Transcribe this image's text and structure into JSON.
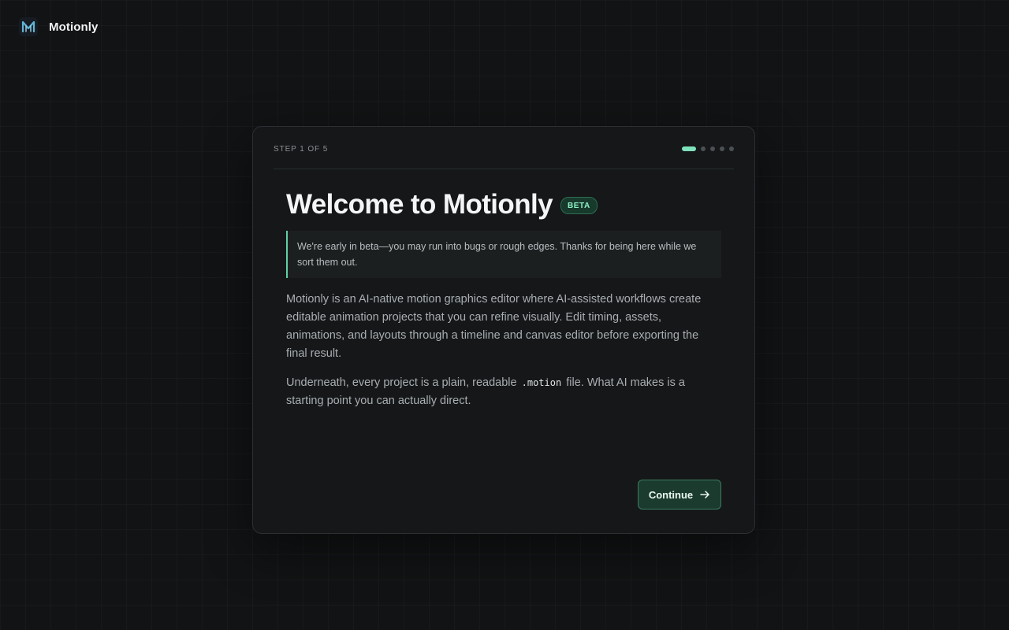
{
  "app": {
    "name": "Motionly",
    "logo_icon": "motionly-m-logo-icon"
  },
  "onboarding": {
    "step_label": "STEP 1 OF 5",
    "total_steps": 5,
    "current_step": 1,
    "title": "Welcome to Motionly",
    "badge": "BETA",
    "notice": "We're early in beta—you may run into bugs or rough edges. Thanks for being here while we sort them out.",
    "paragraph_1": "Motionly is an AI-native motion graphics editor where AI-assisted workflows create editable animation projects that you can refine visually. Edit timing, assets, animations, and layouts through a timeline and canvas editor before exporting the final result.",
    "paragraph_2_before": "Underneath, every project is a plain, readable ",
    "paragraph_2_code": ".motion",
    "paragraph_2_after": " file. What AI makes is a starting point you can actually direct.",
    "continue_label": "Continue",
    "continue_icon": "arrow-right-icon"
  },
  "colors": {
    "background": "#111314",
    "card": "#151718",
    "accent": "#7ee2bc",
    "button_bg": "#1c3b2f"
  }
}
